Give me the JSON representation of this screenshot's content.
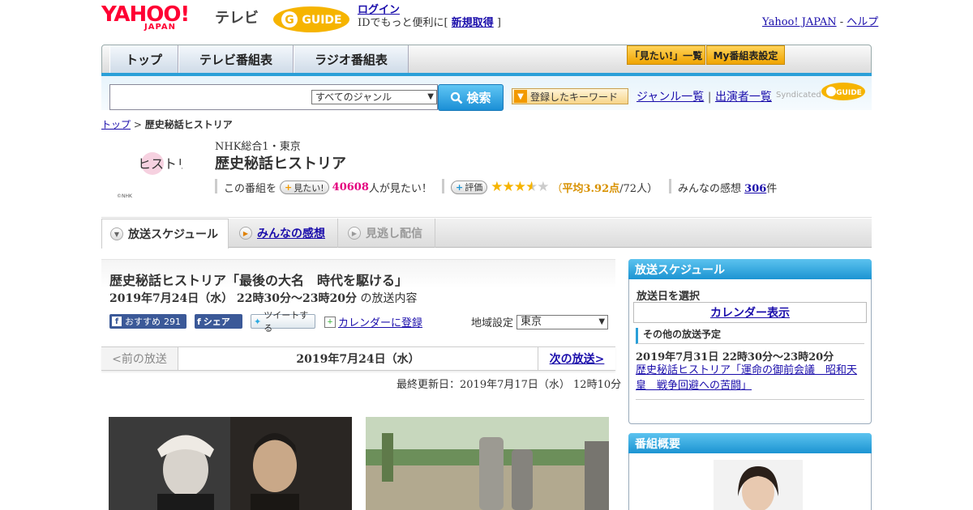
{
  "header": {
    "logo_yahoo": "YAHOO!",
    "logo_japan": "JAPAN",
    "logo_tv": "テレビ",
    "logo_gguide": "G-GUIDE",
    "login_link": "ログイン",
    "login_prefix": "IDでもっと便利に[ ",
    "signup_link": "新規取得",
    "login_suffix": " ]",
    "yahoo_japan_link": "Yahoo! JAPAN",
    "divider": " - ",
    "help_link": "ヘルプ"
  },
  "nav": {
    "tabs": [
      "トップ",
      "テレビ番組表",
      "ラジオ番組表"
    ],
    "watchlist_button": "「見たい!」一覧",
    "my_schedule_button": "My番組表設定"
  },
  "search": {
    "placeholder": "",
    "genre_selected": "すべてのジャンル",
    "search_button": "検索",
    "keyword_button": "登録したキーワード",
    "genre_list_link": "ジャンル一覧",
    "pipe": "|",
    "performer_list_link": "出演者一覧",
    "syndicated": "Syndicated"
  },
  "breadcrumb": {
    "top": "トップ",
    "sep": " > ",
    "current": "歴史秘話ヒストリア"
  },
  "program": {
    "logo_text": "ヒストリア",
    "logo_credit": "©NHK",
    "station": "NHK総合1・東京",
    "title": "歴史秘話ヒストリア",
    "watch_prefix": "この番組を",
    "watch_button": "見たい!",
    "watch_count": "40608",
    "watch_suffix": "人が見たい！",
    "rate_button": "評価",
    "rating_avg_prefix": "（",
    "rating_avg": "平均3.92点",
    "rating_count": "/72人）",
    "rating_stars": 3.92,
    "comments_label": "みんなの感想",
    "comments_count": "306",
    "comments_suffix": "件"
  },
  "tabs": {
    "schedule": "放送スケジュール",
    "comments": "みんなの感想",
    "missed": "見逃し配信"
  },
  "episode": {
    "title": "歴史秘話ヒストリア「最後の大名　時代を駆ける」",
    "datetime": "2019年7月24日（水）  22時30分～23時20分",
    "datetime_suffix": " の放送内容",
    "fb_recommend": "おすすめ",
    "fb_count": "291",
    "fb_share": "シェア",
    "tweet": "ツイートする",
    "calendar_link": "カレンダーに登録",
    "region_label": "地域設定",
    "region_value": "東京",
    "prev": "<前の放送",
    "current_date": "2019年7月24日（水）",
    "next": "次の放送>",
    "updated": "最終更新日：2019年7月17日（水）  12時10分"
  },
  "sidebar": {
    "schedule_head": "放送スケジュール",
    "select_date": "放送日を選択",
    "calendar_button": "カレンダー表示",
    "other_head": "その他の放送予定",
    "other_time": "2019年7月31日  22時30分～23時20分",
    "other_link": "歴史秘話ヒストリア「運命の御前会議　昭和天皇　戦争回避への苦闘」",
    "overview_head": "番組概要"
  },
  "colors": {
    "yahoo_red": "#ff0033",
    "accent_blue": "#2a9fd8",
    "gguide_orange": "#f29a00",
    "pink": "#e4007f",
    "star": "#f6b400"
  }
}
